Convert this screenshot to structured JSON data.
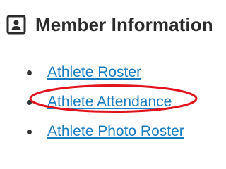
{
  "header": {
    "title": "Member Information",
    "icon": "address-card-icon"
  },
  "menu": {
    "items": [
      {
        "label": "Athlete Roster"
      },
      {
        "label": "Athlete Attendance",
        "highlighted": true
      },
      {
        "label": "Athlete Photo Roster"
      }
    ]
  },
  "colors": {
    "link": "#1a7cc0",
    "heading": "#2b2b2b",
    "highlight": "#e0141e",
    "bullet": "#333333"
  }
}
